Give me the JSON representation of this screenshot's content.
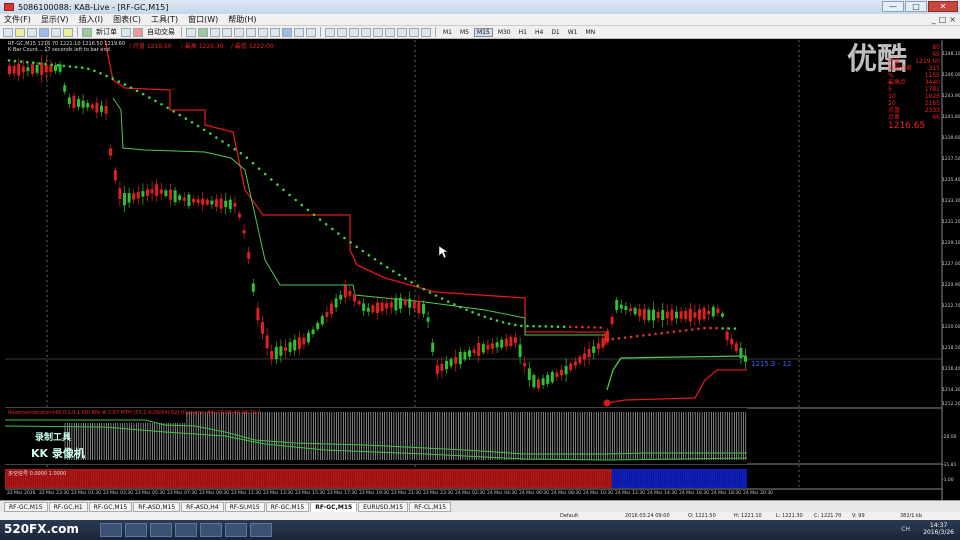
{
  "window": {
    "title": "5086100088: KAB-Live - [RF-GC,M15]",
    "buttons": [
      "—",
      "□",
      "✕"
    ]
  },
  "menu": {
    "items": [
      "文件(F)",
      "显示(V)",
      "插入(I)",
      "图表(C)",
      "工具(T)",
      "窗口(W)",
      "帮助(H)"
    ],
    "mdi_buttons": [
      "_",
      "□",
      "×"
    ]
  },
  "toolbar": {
    "new_order_label": "新订单",
    "auto_trade_label": "自动交易",
    "timeframes": [
      "M1",
      "M5",
      "M15",
      "M30",
      "H1",
      "H4",
      "D1",
      "W1",
      "MN"
    ],
    "active_timeframe": "M15"
  },
  "chart": {
    "header_line1": "RF-GC,M15  1216.70 1221.10 1216.50 1219.60",
    "header_line2": "K Bar Count... 17 seconds left to bar end",
    "header_red": [
      "/ 开盘 1219.50",
      "/ 最高 1225.30",
      "/ 最低 1222.00"
    ],
    "indicator_label": "ReverseIndicators(48,0,1,0,1.00) BN/ #.3.67 MTH [53,1 4.26(64) 02] (Dynamic #4) 17:06:47 18:73:2",
    "sub_label2": "多空信号 0.0000 1.0000",
    "current_price_tag": "1215.3 - 12",
    "tool_overlay_line1": "录制工具",
    "tool_overlay_line2": "KK 录像机",
    "watermark": "优酷",
    "info_panel": {
      "rows": [
        [
          "",
          "80"
        ],
        [
          "",
          "65"
        ],
        [
          "开盘",
          "1219.60"
        ],
        [
          "当前价差",
          "-315"
        ],
        [
          "%",
          "1155"
        ],
        [
          "最高点",
          "3440"
        ],
        [
          "5",
          "1781"
        ],
        [
          "10 ",
          "1926"
        ],
        [
          "20 ",
          "2165"
        ],
        [
          "点值",
          "2333"
        ],
        [
          "点差",
          "66"
        ]
      ],
      "big_price": "1216.65"
    },
    "price_axis": [
      "1248.10",
      "1246.00",
      "1243.90",
      "1241.80",
      "1239.60",
      "1237.50",
      "1235.40",
      "1233.30",
      "1231.20",
      "1229.10",
      "1227.00",
      "1224.90",
      "1222.70",
      "1220.60",
      "1218.50",
      "1216.40",
      "1214.30",
      "1212.20",
      "-20.00",
      "-31.81",
      "-1.00"
    ],
    "time_axis": [
      "22 Mar 2016",
      "22 Mar 23:30",
      "23 Mar 01:30",
      "23 Mar 03:30",
      "23 Mar 05:30",
      "23 Mar 07:30",
      "23 Mar 09:30",
      "23 Mar 11:30",
      "23 Mar 13:30",
      "23 Mar 15:30",
      "23 Mar 17:30",
      "23 Mar 19:30",
      "23 Mar 21:30",
      "23 Mar 23:30",
      "24 Mar 02:30",
      "24 Mar 04:30",
      "24 Mar 06:30",
      "24 Mar 08:30",
      "24 Mar 10:30",
      "24 Mar 12:30",
      "24 Mar 14:30",
      "24 Mar 16:30",
      "24 Mar 18:30",
      "24 Mar 20:30"
    ]
  },
  "tabs": {
    "items": [
      "RF-GC,M15",
      "RF-GC,H1",
      "RF-GC,M15",
      "RF-ASD,M15",
      "RF-ASD,H4",
      "RF-SI,M15",
      "RF-GC,M15",
      "RF-GC,M15",
      "EURUSD,M15",
      "RF-CL,M15"
    ],
    "active_index": 7
  },
  "status": {
    "profile": "Default",
    "datetime": "2016.03.24 09:00",
    "open": "O: 1221.50",
    "high": "H: 1221.10",
    "low": "L: 1221.30",
    "close": "C: 1221.70",
    "volume": "V: 99",
    "traffic": "382/1 kb"
  },
  "taskbar": {
    "brand": "520FX.com",
    "tray": "CH",
    "time": "14:37",
    "date": "2016/3/26"
  }
}
